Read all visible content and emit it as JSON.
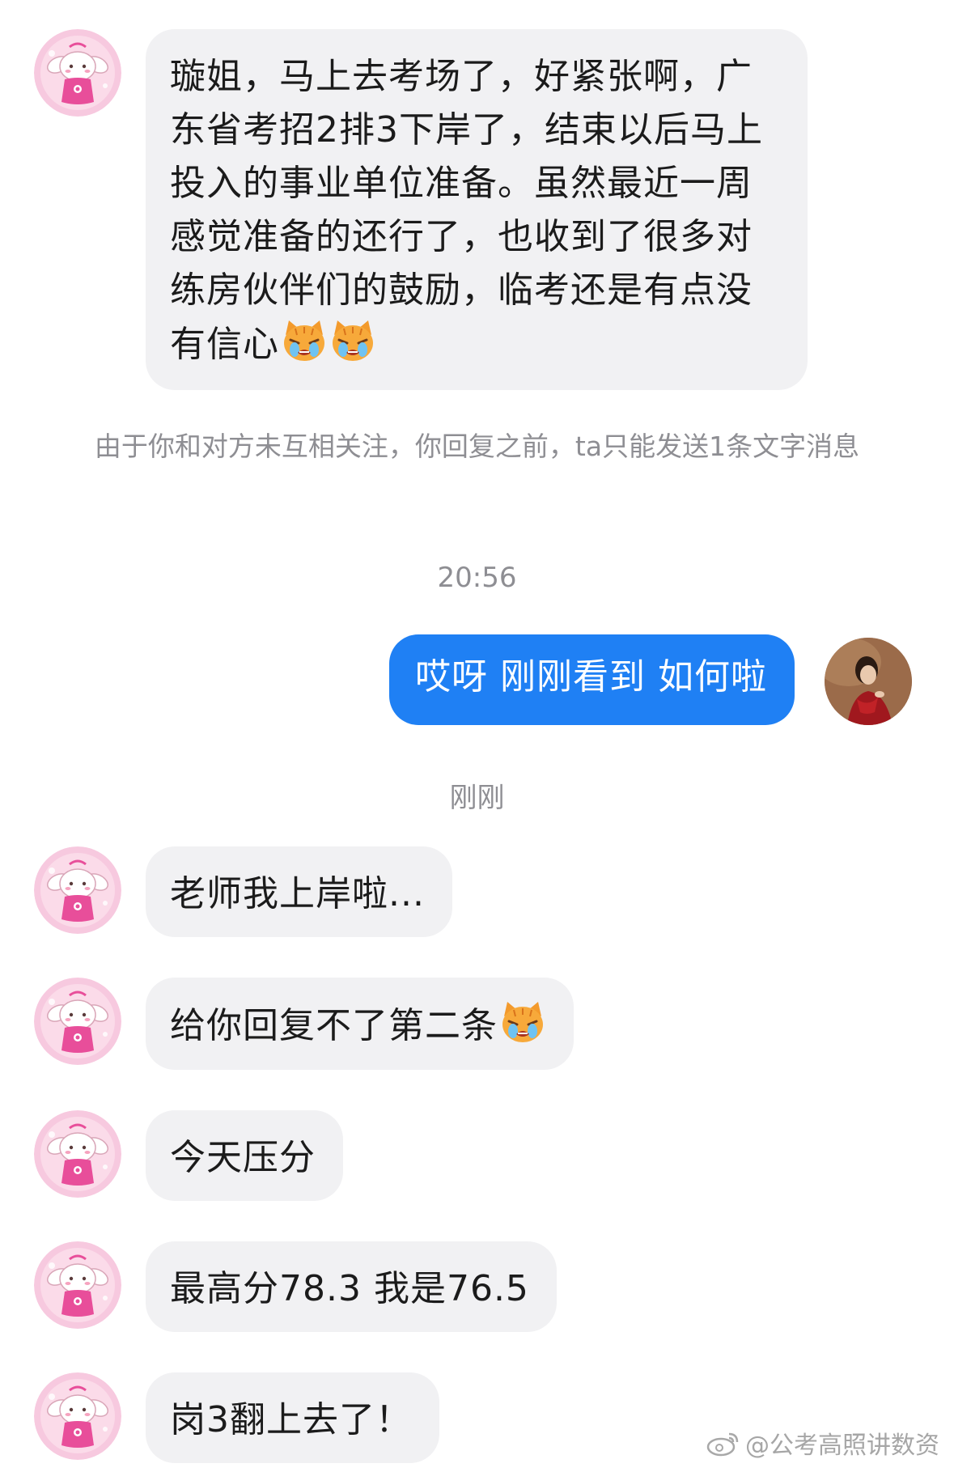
{
  "messages": {
    "m1": {
      "sender": "other",
      "text": "璇姐，马上去考场了，好紧张啊，广东省考招2排3下岸了，结束以后马上投入的事业单位准备。虽然最近一周感觉准备的还行了，也收到了很多对练房伙伴们的鼓励，临考还是有点没有信心",
      "emoji": [
        "crying-cat-emoji",
        "crying-cat-emoji"
      ]
    },
    "notice": "由于你和对方未互相关注，你回复之前，ta只能发送1条文字消息",
    "time1": "20:56",
    "m2": {
      "sender": "me",
      "text": "哎呀 刚刚看到 如何啦"
    },
    "time2": "刚刚",
    "m3": {
      "sender": "other",
      "text": "老师我上岸啦..."
    },
    "m4": {
      "sender": "other",
      "text": "给你回复不了第二条",
      "emoji": [
        "crying-cat-emoji"
      ]
    },
    "m5": {
      "sender": "other",
      "text": "今天压分"
    },
    "m6": {
      "sender": "other",
      "text": "最高分78.3 我是76.5"
    },
    "m7": {
      "sender": "other",
      "text": "岗3翻上去了！"
    }
  },
  "watermark": "@公考高照讲数资",
  "colors": {
    "outgoing_bubble": "#1f80f4",
    "incoming_bubble": "#f1f1f3",
    "system_text": "#8e8e93"
  }
}
